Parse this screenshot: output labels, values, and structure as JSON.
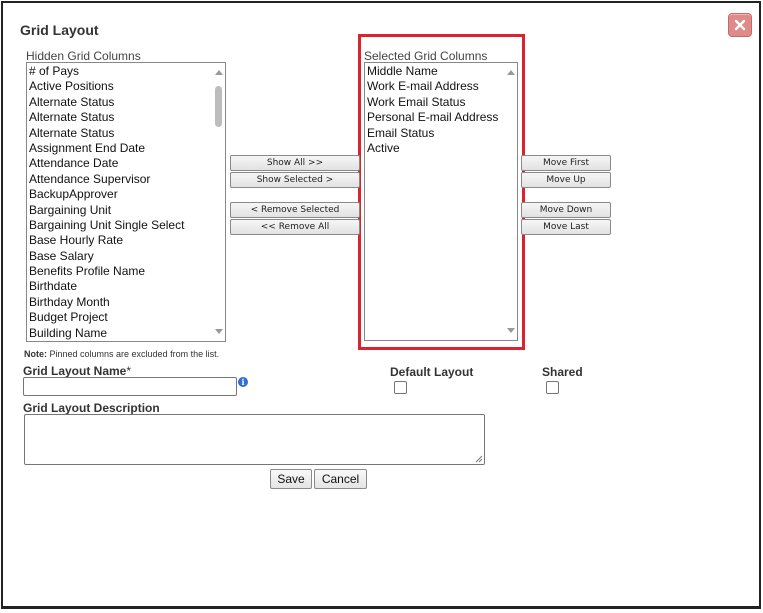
{
  "dialog": {
    "title": "Grid Layout",
    "close_icon": "close-x-icon"
  },
  "hidden_columns": {
    "label": "Hidden Grid Columns",
    "items": [
      "# of Pays",
      "Active Positions",
      "Alternate Status",
      "Alternate Status",
      "Alternate Status",
      "Assignment End Date",
      "Attendance Date",
      "Attendance Supervisor",
      "BackupApprover",
      "Bargaining Unit",
      "Bargaining Unit Single Select",
      "Base Hourly Rate",
      "Base Salary",
      "Benefits Profile Name",
      "Birthdate",
      "Birthday Month",
      "Budget Project",
      "Building Name"
    ]
  },
  "selected_columns": {
    "label": "Selected Grid Columns",
    "items": [
      "Middle Name",
      "Work E-mail Address",
      "Work Email Status",
      "Personal E-mail Address",
      "Email Status",
      "Active"
    ]
  },
  "transfer_buttons": {
    "show_all": "Show All >>",
    "show_selected": "Show Selected >",
    "remove_selected": "< Remove Selected",
    "remove_all": "<< Remove All"
  },
  "order_buttons": {
    "move_first": "Move First",
    "move_up": "Move Up",
    "move_down": "Move Down",
    "move_last": "Move Last"
  },
  "note": {
    "prefix": "Note:",
    "text": " Pinned columns are excluded from the list."
  },
  "form": {
    "name_label": "Grid Layout Name",
    "required_mark": "*",
    "name_value": "",
    "default_layout_label": "Default Layout",
    "default_layout_checked": false,
    "shared_label": "Shared",
    "shared_checked": false,
    "description_label": "Grid Layout Description",
    "description_value": "",
    "info_icon": "info-icon",
    "info_glyph": "i"
  },
  "actions": {
    "save": "Save",
    "cancel": "Cancel"
  },
  "colors": {
    "highlight": "#d9232e",
    "close_button": "#e08a8a"
  }
}
